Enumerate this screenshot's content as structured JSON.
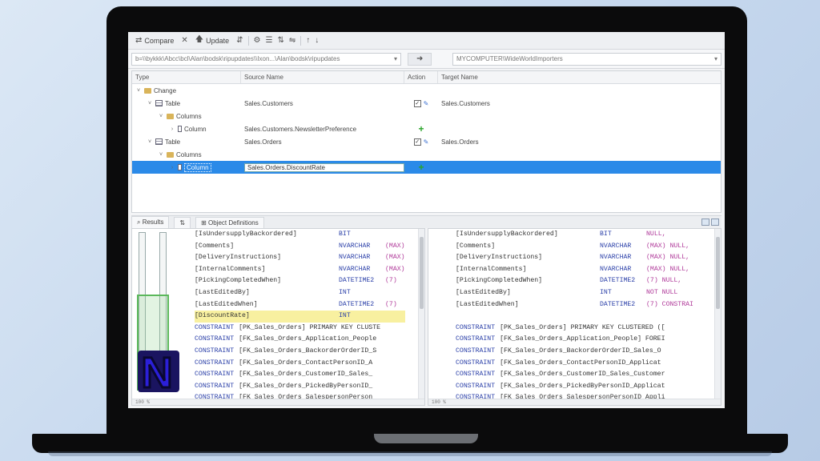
{
  "toolbar": {
    "compare_label": "Compare",
    "update_label": "Update"
  },
  "paths": {
    "source": "b=\\\\bykkk\\Abcc\\bcl\\Alan\\bodsk\\ripupdates\\\\Ixon...\\Alan\\bodsk\\ripupdates",
    "target": "MYCOMPUTER\\WideWorldImporters"
  },
  "grid": {
    "headers": {
      "type": "Type",
      "source": "Source Name",
      "action": "Action",
      "target": "Target Name"
    },
    "rows": [
      {
        "indent": 0,
        "chev": "˅",
        "icon": "folder",
        "type": "Change",
        "source": "",
        "target": "",
        "check": false,
        "edit": false,
        "add": false,
        "selected": false
      },
      {
        "indent": 1,
        "chev": "˅",
        "icon": "table",
        "type": "Table",
        "source": "Sales.Customers",
        "target": "Sales.Customers",
        "check": true,
        "edit": true,
        "add": false,
        "selected": false
      },
      {
        "indent": 2,
        "chev": "˅",
        "icon": "folder",
        "type": "Columns",
        "source": "",
        "target": "",
        "check": false,
        "edit": false,
        "add": false,
        "selected": false
      },
      {
        "indent": 3,
        "chev": "›",
        "icon": "column",
        "type": "Column",
        "source": "Sales.Customers.NewsletterPreference",
        "target": "",
        "check": false,
        "edit": false,
        "add": true,
        "selected": false
      },
      {
        "indent": 1,
        "chev": "˅",
        "icon": "table",
        "type": "Table",
        "source": "Sales.Orders",
        "target": "Sales.Orders",
        "check": true,
        "edit": true,
        "add": false,
        "selected": false
      },
      {
        "indent": 2,
        "chev": "˅",
        "icon": "folder",
        "type": "Columns",
        "source": "",
        "target": "",
        "check": false,
        "edit": false,
        "add": false,
        "selected": false
      },
      {
        "indent": 3,
        "chev": "›",
        "icon": "column",
        "type": "Column",
        "source": "Sales.Orders.DiscountRate",
        "target": "",
        "check": false,
        "edit": false,
        "add": true,
        "selected": true
      }
    ]
  },
  "tabs": {
    "results": "Results",
    "object_definitions": "Object Definitions"
  },
  "left_code": [
    {
      "name": "[IsUndersupplyBackordered]",
      "type": "BIT",
      "null": "",
      "hl": false
    },
    {
      "name": "[Comments]",
      "type": "NVARCHAR",
      "null": "(MAX)",
      "hl": false
    },
    {
      "name": "[DeliveryInstructions]",
      "type": "NVARCHAR",
      "null": "(MAX)",
      "hl": false
    },
    {
      "name": "[InternalComments]",
      "type": "NVARCHAR",
      "null": "(MAX)",
      "hl": false
    },
    {
      "name": "[PickingCompletedWhen]",
      "type": "DATETIME2",
      "null": "(7)",
      "hl": false
    },
    {
      "name": "[LastEditedBy]",
      "type": "INT",
      "null": "",
      "hl": false
    },
    {
      "name": "[LastEditedWhen]",
      "type": "DATETIME2",
      "null": "(7)",
      "hl": false
    },
    {
      "name": "[DiscountRate]",
      "type": "INT",
      "null": "",
      "hl": true
    },
    {
      "kw": "CONSTRAINT",
      "con": "[PK_Sales_Orders] PRIMARY KEY CLUSTE"
    },
    {
      "kw": "CONSTRAINT",
      "con": "[FK_Sales_Orders_Application_People"
    },
    {
      "kw": "CONSTRAINT",
      "con": "[FK_Sales_Orders_BackorderOrderID_S"
    },
    {
      "kw": "CONSTRAINT",
      "con": "[FK_Sales_Orders_ContactPersonID_A"
    },
    {
      "kw": "CONSTRAINT",
      "con": "[FK_Sales_Orders_CustomerID_Sales_"
    },
    {
      "kw": "CONSTRAINT",
      "con": "[FK_Sales_Orders_PickedByPersonID_"
    },
    {
      "kw": "CONSTRAINT",
      "con": "[FK_Sales_Orders_SalespersonPerson"
    }
  ],
  "right_code": [
    {
      "name": "[IsUndersupplyBackordered]",
      "type": "BIT",
      "null": "NULL,",
      "hl": false
    },
    {
      "name": "[Comments]",
      "type": "NVARCHAR",
      "null": "(MAX) NULL,",
      "hl": false
    },
    {
      "name": "[DeliveryInstructions]",
      "type": "NVARCHAR",
      "null": "(MAX) NULL,",
      "hl": false
    },
    {
      "name": "[InternalComments]",
      "type": "NVARCHAR",
      "null": "(MAX) NULL,",
      "hl": false
    },
    {
      "name": "[PickingCompletedWhen]",
      "type": "DATETIME2",
      "null": "(7) NULL,",
      "hl": false
    },
    {
      "name": "[LastEditedBy]",
      "type": "INT",
      "null": "NOT NULL",
      "hl": false
    },
    {
      "name": "[LastEditedWhen]",
      "type": "DATETIME2",
      "null": "(7) CONSTRAI",
      "hl": false
    },
    {
      "blank": true
    },
    {
      "kw": "CONSTRAINT",
      "con": "[PK_Sales_Orders] PRIMARY KEY CLUSTERED (["
    },
    {
      "kw": "CONSTRAINT",
      "con": "[FK_Sales_Orders_Application_People] FOREI"
    },
    {
      "kw": "CONSTRAINT",
      "con": "[FK_Sales_Orders_BackorderOrderID_Sales_O"
    },
    {
      "kw": "CONSTRAINT",
      "con": "[FK_Sales_Orders_ContactPersonID_Applicat"
    },
    {
      "kw": "CONSTRAINT",
      "con": "[FK_Sales_Orders_CustomerID_Sales_Customer"
    },
    {
      "kw": "CONSTRAINT",
      "con": "[FK_Sales_Orders_PickedByPersonID_Applicat"
    },
    {
      "kw": "CONSTRAINT",
      "con": "[FK_Sales_Orders_SalespersonPersonID_Appli"
    }
  ],
  "zoom": {
    "left": "100 %",
    "right": "100 %"
  },
  "logo_letter": "N",
  "colors": {
    "selection": "#2b8ae8",
    "highlight": "#f8f0a0",
    "keyword": "#2a3fa8",
    "logo": "#2b1fd8"
  }
}
